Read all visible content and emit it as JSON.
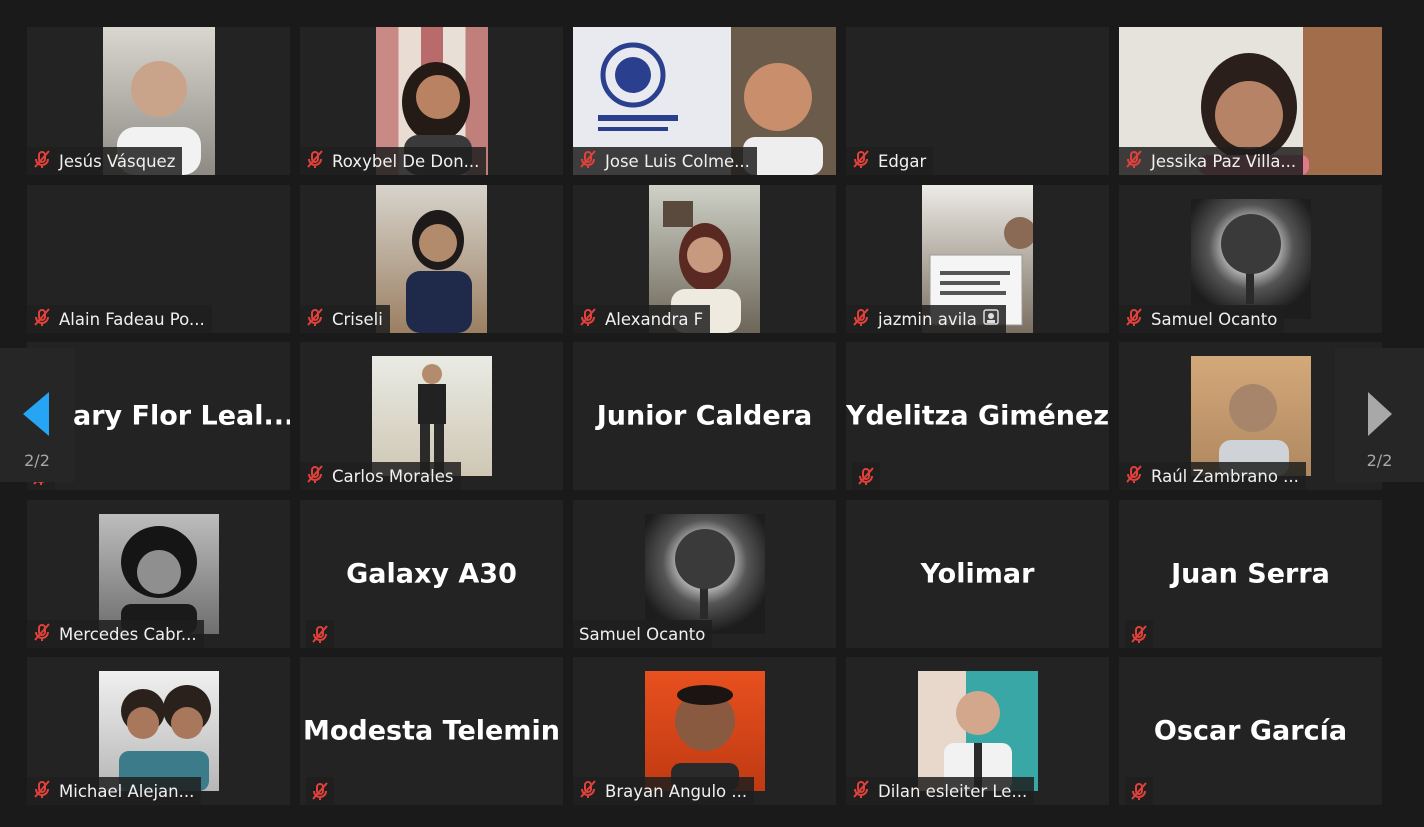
{
  "pagination": {
    "left_label": "2/2",
    "right_label": "2/2"
  },
  "colors": {
    "accent": "#27a5f5",
    "muted_icon": "#e0413a"
  },
  "participants": [
    {
      "name": "Jesús Vásquez",
      "muted": true,
      "video": "person"
    },
    {
      "name": "Roxybel De Don...",
      "muted": true,
      "video": "person"
    },
    {
      "name": "Jose Luis Colme...",
      "muted": true,
      "video": "person-with-logo"
    },
    {
      "name": "Edgar",
      "muted": true,
      "video": "none"
    },
    {
      "name": "Jessika Paz Villa...",
      "muted": true,
      "video": "person"
    },
    {
      "name": "Alain Fadeau Po...",
      "muted": true,
      "video": "none"
    },
    {
      "name": "Criseli",
      "muted": true,
      "video": "person"
    },
    {
      "name": "Alexandra F",
      "muted": true,
      "video": "person"
    },
    {
      "name": "jazmin avila",
      "muted": true,
      "video": "person-with-sign",
      "badge": "share-icon"
    },
    {
      "name": "Samuel Ocanto",
      "muted": true,
      "video": "tree-photo"
    },
    {
      "name": "ary Flor Leal...",
      "muted": true,
      "video": "name-only"
    },
    {
      "name": "Carlos Morales",
      "muted": true,
      "video": "person"
    },
    {
      "name": "Junior Caldera",
      "muted": false,
      "video": "name-only"
    },
    {
      "name": "Ydelitza Giménez",
      "muted": true,
      "video": "name-only"
    },
    {
      "name": "Raúl Zambrano ...",
      "muted": true,
      "video": "person"
    },
    {
      "name": "Mercedes Cabr...",
      "muted": true,
      "video": "person-bw"
    },
    {
      "name": "Galaxy A30",
      "muted": true,
      "video": "name-only"
    },
    {
      "name": "Samuel Ocanto",
      "muted": false,
      "video": "tree-photo"
    },
    {
      "name": "Yolimar",
      "muted": false,
      "video": "name-only"
    },
    {
      "name": "Juan Serra",
      "muted": true,
      "video": "name-only"
    },
    {
      "name": "Michael Alejan...",
      "muted": true,
      "video": "person"
    },
    {
      "name": "Modesta Telemin",
      "muted": true,
      "video": "name-only"
    },
    {
      "name": "Brayan Angulo ...",
      "muted": true,
      "video": "person"
    },
    {
      "name": "Dilan esleiter Le...",
      "muted": true,
      "video": "person"
    },
    {
      "name": "Oscar García",
      "muted": true,
      "video": "name-only"
    }
  ]
}
